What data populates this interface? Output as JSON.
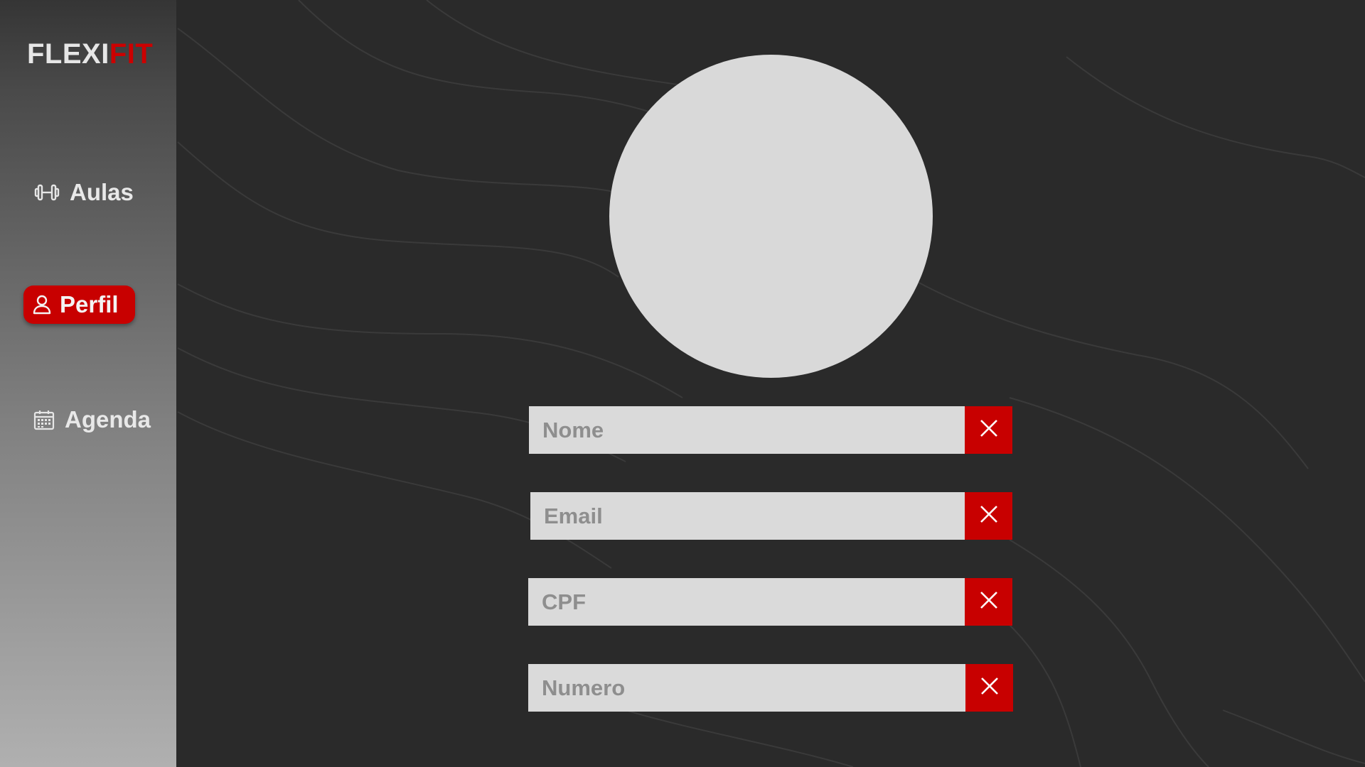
{
  "brand": {
    "name_part1": "FLEXI",
    "name_part2": "FIT",
    "accent_color": "#cc0000"
  },
  "sidebar": {
    "items": [
      {
        "label": "Aulas",
        "icon": "dumbbell-icon",
        "active": false
      },
      {
        "label": "Perfil",
        "icon": "user-icon",
        "active": true
      },
      {
        "label": "Agenda",
        "icon": "calendar-icon",
        "active": false
      }
    ]
  },
  "profile": {
    "avatar": "avatar-placeholder",
    "fields": [
      {
        "placeholder": "Nome",
        "value": "",
        "action_icon": "close-icon"
      },
      {
        "placeholder": "Email",
        "value": "",
        "action_icon": "close-icon"
      },
      {
        "placeholder": "CPF",
        "value": "",
        "action_icon": "close-icon"
      },
      {
        "placeholder": "Numero",
        "value": "",
        "action_icon": "close-icon"
      }
    ]
  },
  "colors": {
    "background": "#2a2a2a",
    "field_background": "#dadada",
    "button": "#c80000"
  }
}
